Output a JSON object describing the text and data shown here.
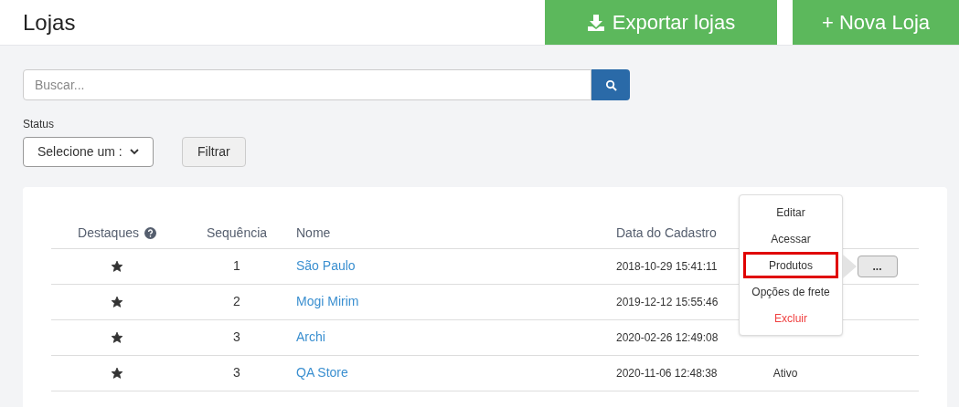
{
  "header": {
    "title": "Lojas",
    "buttons": [
      {
        "label": "Exportar lojas",
        "kind": "export"
      },
      {
        "label": "+ Nova Loja",
        "kind": "new"
      }
    ]
  },
  "search": {
    "placeholder": "Buscar..."
  },
  "filter": {
    "label": "Status",
    "select_value": "Selecione um :",
    "button": "Filtrar"
  },
  "table": {
    "columns": [
      "Destaques",
      "Sequência",
      "Nome",
      "Data do Cadastro"
    ],
    "rows": [
      {
        "featured": true,
        "sequence": "1",
        "name": "São Paulo",
        "date": "2018-10-29 15:41:11",
        "actions": true
      },
      {
        "featured": true,
        "sequence": "2",
        "name": "Mogi Mirim",
        "date": "2019-12-12 15:55:46",
        "actions": false
      },
      {
        "featured": true,
        "sequence": "3",
        "name": "Archi",
        "date": "2020-02-26 12:49:08",
        "actions": false
      },
      {
        "featured": true,
        "sequence": "3",
        "name": "QA Store",
        "date": "2020-11-06 12:48:38",
        "status": "Ativo",
        "actions": false
      }
    ]
  },
  "action_menu": {
    "button": "...",
    "items": [
      {
        "label": "Editar",
        "kind": "normal",
        "highlighted": false
      },
      {
        "label": "Acessar",
        "kind": "normal",
        "highlighted": false
      },
      {
        "label": "Produtos",
        "kind": "normal",
        "highlighted": true
      },
      {
        "label": "Opções de frete",
        "kind": "normal",
        "highlighted": false
      },
      {
        "label": "Excluir",
        "kind": "danger",
        "highlighted": false
      }
    ]
  }
}
